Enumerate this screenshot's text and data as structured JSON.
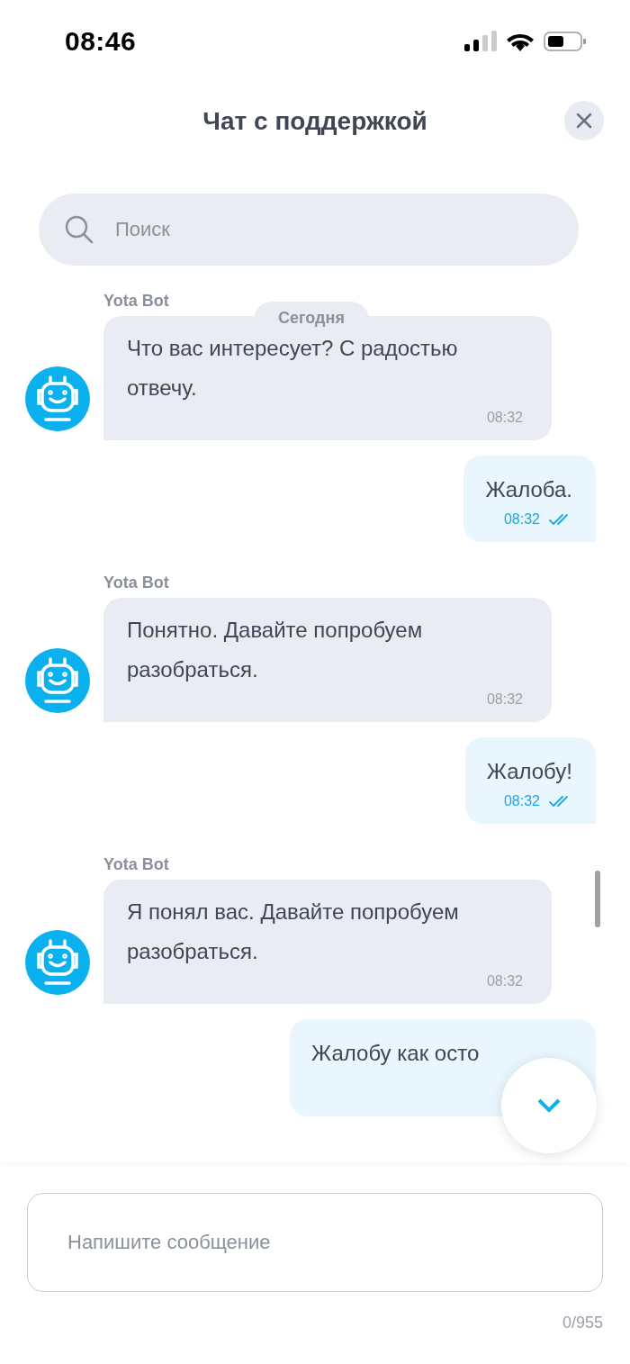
{
  "status_bar": {
    "time": "08:46"
  },
  "header": {
    "title": "Чат с поддержкой"
  },
  "search": {
    "placeholder": "Поиск"
  },
  "date_divider": "Сегодня",
  "messages": [
    {
      "kind": "bot",
      "sender": "Yota Bot",
      "text": "Что вас интересует? С радостью отвечу.",
      "time": "08:32"
    },
    {
      "kind": "user",
      "text": "Жалоба.",
      "time": "08:32",
      "read": true
    },
    {
      "kind": "bot",
      "sender": "Yota Bot",
      "text": "Понятно. Давайте попробуем разобраться.",
      "time": "08:32"
    },
    {
      "kind": "user",
      "text": "Жалобу!",
      "time": "08:32",
      "read": true
    },
    {
      "kind": "bot",
      "sender": "Yota Bot",
      "text": "Я понял вас. Давайте попробуем разобраться.",
      "time": "08:32"
    },
    {
      "kind": "user",
      "text": "Жалобу как осто"
    }
  ],
  "composer": {
    "placeholder": "Напишите сообщение",
    "counter": "0/955"
  }
}
